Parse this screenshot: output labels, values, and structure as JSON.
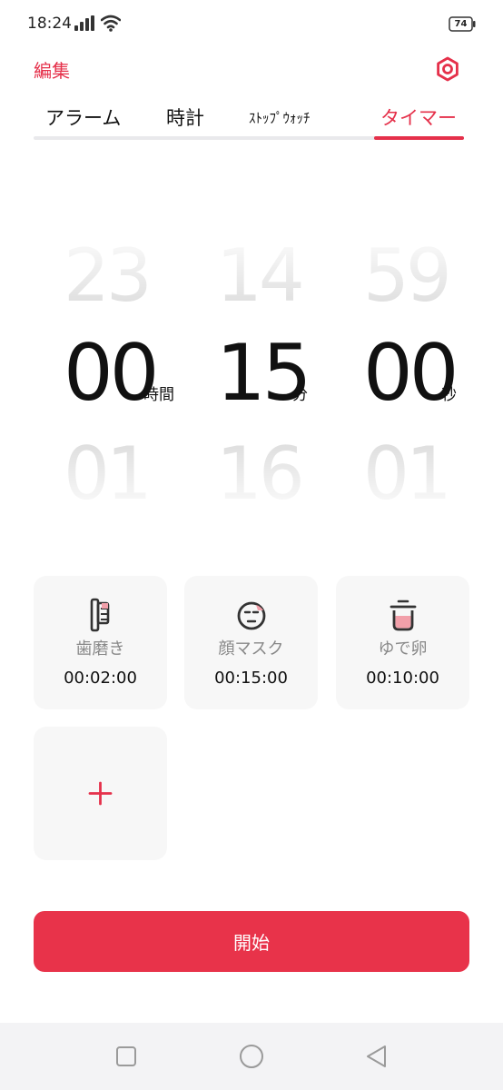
{
  "status_bar": {
    "time": "18:24",
    "battery": "74"
  },
  "header": {
    "edit_label": "編集"
  },
  "tabs": [
    {
      "label": "アラーム",
      "active": false
    },
    {
      "label": "時計",
      "active": false
    },
    {
      "label": "ｽﾄｯﾌﾟｳｫｯﾁ",
      "active": false
    },
    {
      "label": "タイマー",
      "active": true
    }
  ],
  "picker": {
    "hours": {
      "prev": "23",
      "value": "00",
      "next": "01",
      "unit": "時間"
    },
    "minutes": {
      "prev": "14",
      "value": "15",
      "next": "16",
      "unit": "分"
    },
    "seconds": {
      "prev": "59",
      "value": "00",
      "next": "01",
      "unit": "秒"
    }
  },
  "presets": [
    {
      "name": "歯磨き",
      "time": "00:02:00",
      "icon": "toothbrush-icon"
    },
    {
      "name": "顔マスク",
      "time": "00:15:00",
      "icon": "face-mask-icon"
    },
    {
      "name": "ゆで卵",
      "time": "00:10:00",
      "icon": "pot-icon"
    }
  ],
  "start_label": "開始",
  "colors": {
    "accent": "#e5304a",
    "card": "#f7f7f7",
    "nav": "#f3f3f5"
  }
}
